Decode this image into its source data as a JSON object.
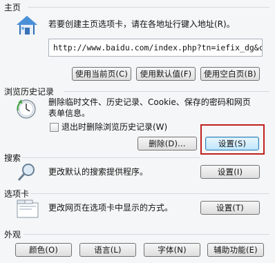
{
  "home": {
    "title": "主页",
    "description": "若要创建主页选项卡，请在各地址行键入地址(R)。",
    "url": "http://www.baidu.com/index.php?tn=iefix_dg&c",
    "buttons": {
      "use_current": "使用当前页(C)",
      "use_default": "使用默认值(F)",
      "use_blank": "使用空白页(B)"
    }
  },
  "history": {
    "title": "浏览历史记录",
    "description_line1": "删除临时文件、历史记录、Cookie、保存的密码和网页",
    "description_line2": "表单信息。",
    "checkbox_label": "退出时删除浏览历史记录(W)",
    "checkbox_checked": false,
    "delete_button": "删除(D)...",
    "settings_button": "设置(S)"
  },
  "search": {
    "title": "搜索",
    "description": "更改默认的搜索提供程序。",
    "settings_button": "设置(I)"
  },
  "tabs": {
    "title": "选项卡",
    "description": "更改网页在选项卡中显示的方式。",
    "settings_button": "设置(T)"
  },
  "appearance": {
    "title": "外观",
    "buttons": {
      "colors": "颜色(O)",
      "languages": "语言(L)",
      "fonts": "字体(N)",
      "accessibility": "辅助功能(E)"
    }
  },
  "colors": {
    "highlight": "#c0201c",
    "focus_button": "#bee6fd"
  }
}
